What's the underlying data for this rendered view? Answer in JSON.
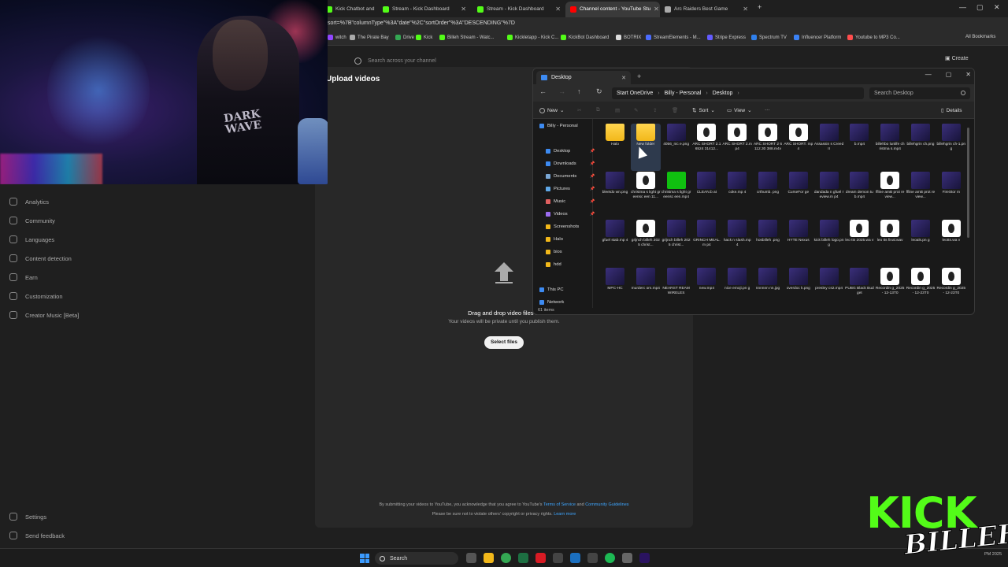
{
  "browser": {
    "tabs": [
      {
        "label": "Kick Chatbot and",
        "icon_color": "#53fc18"
      },
      {
        "label": "Stream - Kick Dashboard",
        "icon_color": "#53fc18"
      },
      {
        "label": "Stream - Kick Dashboard",
        "icon_color": "#53fc18"
      },
      {
        "label": "Channel content - YouTube Stu",
        "icon_color": "#ff0000"
      },
      {
        "label": "Arc Raiders Best Game",
        "icon_color": "#aaaaaa"
      }
    ],
    "url": "sort=%7B\"columnType\"%3A\"date\"%2C\"sortOrder\"%3A\"DESCENDING\"%7D",
    "bookmarks": [
      {
        "label": "witch",
        "color": "#9146ff"
      },
      {
        "label": "The Pirate Bay",
        "color": "#aaaaaa"
      },
      {
        "label": "Drive",
        "color": "#34a853"
      },
      {
        "label": "Kick",
        "color": "#53fc18"
      },
      {
        "label": "Billeh Stream - Watc...",
        "color": "#53fc18"
      },
      {
        "label": "Kickletapp - Kick C...",
        "color": "#53fc18"
      },
      {
        "label": "KickBot Dashboard",
        "color": "#53fc18"
      },
      {
        "label": "BOTRIX",
        "color": "#dddddd"
      },
      {
        "label": "StreamElements - M...",
        "color": "#4b6cff"
      },
      {
        "label": "Stripe Express",
        "color": "#635bff"
      },
      {
        "label": "Spectrum TV",
        "color": "#2f80ed"
      },
      {
        "label": "Influencer Platform",
        "color": "#3b82f6"
      },
      {
        "label": "Youtube to MP3 Co...",
        "color": "#ff4d4d"
      }
    ],
    "all_bookmarks": "All Bookmarks"
  },
  "youtube": {
    "search_placeholder": "Search across your channel",
    "create_label": "Create",
    "sidebar": [
      {
        "label": "Analytics"
      },
      {
        "label": "Community"
      },
      {
        "label": "Languages"
      },
      {
        "label": "Content detection"
      },
      {
        "label": "Earn"
      },
      {
        "label": "Customization"
      },
      {
        "label": "Creator Music [Beta]"
      }
    ],
    "sidebar_bottom": [
      {
        "label": "Settings"
      },
      {
        "label": "Send feedback"
      }
    ],
    "upload": {
      "title": "Upload videos",
      "drag_text": "Drag and drop video files to",
      "private_text": "Your videos will be private until you publish them.",
      "select_files": "Select files",
      "terms_prefix": "By submitting your videos to YouTube, you acknowledge that you agree to YouTube's",
      "terms_link": "Terms of Service",
      "terms_and": "and",
      "guidelines_link": "Community Guidelines",
      "copyright_text": "Please be sure not to violate others' copyright or privacy rights.",
      "learn_more": "Learn more"
    }
  },
  "explorer": {
    "tab_title": "Desktop",
    "breadcrumb": [
      "Start OneDrive",
      "Billy - Personal",
      "Desktop"
    ],
    "search_placeholder": "Search Desktop",
    "toolbar": {
      "new": "New",
      "sort": "Sort",
      "view": "View",
      "more": "···",
      "details": "Details"
    },
    "nav": [
      {
        "label": "Billy - Personal",
        "color": "#3d8bf2"
      },
      {
        "label": "Desktop",
        "color": "#3d8bf2",
        "pin": "📌"
      },
      {
        "label": "Downloads",
        "color": "#3d8bf2",
        "pin": "📌"
      },
      {
        "label": "Documents",
        "color": "#7aa7d6",
        "pin": "📌"
      },
      {
        "label": "Pictures",
        "color": "#5fa8e8",
        "pin": "📌"
      },
      {
        "label": "Music",
        "color": "#e06060",
        "pin": "📌"
      },
      {
        "label": "Videos",
        "color": "#9b6cf0",
        "pin": "📌"
      },
      {
        "label": "Screenshots",
        "color": "#f2b81a"
      },
      {
        "label": "Halo",
        "color": "#f2b81a"
      },
      {
        "label": "bios",
        "color": "#f2b81a"
      },
      {
        "label": "hdd",
        "color": "#f2b81a"
      },
      {
        "label": "This PC",
        "color": "#3d8bf2"
      },
      {
        "label": "Network",
        "color": "#3d8bf2"
      }
    ],
    "status": "61 items",
    "files": [
      {
        "label": "Halo",
        "kind": "folder"
      },
      {
        "label": "New folder",
        "kind": "folder"
      },
      {
        "label": "4056_nic e.png",
        "kind": "img"
      },
      {
        "label": "ARC SHORT 2.16524 31412...",
        "kind": "video"
      },
      {
        "label": "ARC SHORT 2.mp4",
        "kind": "video"
      },
      {
        "label": "ARC SHORT 2 6112.30 388.m4v",
        "kind": "video"
      },
      {
        "label": "ARC SHORT. mp4",
        "kind": "video"
      },
      {
        "label": "Assassin s Creed II",
        "kind": "img"
      },
      {
        "label": "b.mp4",
        "kind": "img"
      },
      {
        "label": "billehbo lunlife christma s.mp4",
        "kind": "img"
      },
      {
        "label": "billehgrin ch.png",
        "kind": "img"
      },
      {
        "label": "billehgrin ch-1.png",
        "kind": "img"
      },
      {
        "label": "bleetdo wn.png",
        "kind": "img"
      },
      {
        "label": "christma s light greensc een 11...",
        "kind": "video"
      },
      {
        "label": "christma s light greensc een.mp4",
        "kind": "green"
      },
      {
        "label": "CLEAN.b at",
        "kind": "img"
      },
      {
        "label": "coke.mp 4",
        "kind": "img"
      },
      {
        "label": "crthumb. png",
        "kind": "img"
      },
      {
        "label": "CurseFor ge",
        "kind": "img"
      },
      {
        "label": "dandada n gfuel review.m p4",
        "kind": "img"
      },
      {
        "label": "dream demon tub.mp4",
        "kind": "img"
      },
      {
        "label": "ffline amB prot review...",
        "kind": "video"
      },
      {
        "label": "ffline amB prot review...",
        "kind": "img"
      },
      {
        "label": "FireStor m",
        "kind": "img"
      },
      {
        "label": "gfuel stab.mp 4",
        "kind": "img"
      },
      {
        "label": "grijnch billeh 2025 christ...",
        "kind": "video"
      },
      {
        "label": "grijnch billeh 2025 christ...",
        "kind": "img"
      },
      {
        "label": "GRINCH MEAL.m p4",
        "kind": "img"
      },
      {
        "label": "hack n slash.mp 4",
        "kind": "img"
      },
      {
        "label": "hosbilleh .png",
        "kind": "img"
      },
      {
        "label": "HYTE Nexus",
        "kind": "img"
      },
      {
        "label": "kick billeh logo.png",
        "kind": "img"
      },
      {
        "label": "leo tts 2025.wa v",
        "kind": "video"
      },
      {
        "label": "leo tts final.wav",
        "kind": "video"
      },
      {
        "label": "leoals.pn g",
        "kind": "img"
      },
      {
        "label": "leotts.wa v",
        "kind": "video"
      },
      {
        "label": "MPC-HC",
        "kind": "img"
      },
      {
        "label": "murderc om.mp4",
        "kind": "img"
      },
      {
        "label": "NEARST REAM WIRELES",
        "kind": "img"
      },
      {
        "label": "new.mp4",
        "kind": "img"
      },
      {
        "label": "nice emoji.pn g",
        "kind": "img"
      },
      {
        "label": "nnnnnn nn.jpg",
        "kind": "img"
      },
      {
        "label": "overdoc k.png",
        "kind": "img"
      },
      {
        "label": "presley cs2.mp4",
        "kind": "img"
      },
      {
        "label": "PUBG Black Budget",
        "kind": "img"
      },
      {
        "label": "Recordin g_2025- 12-13T0",
        "kind": "video"
      },
      {
        "label": "Recordin g_2025- 12-23T0",
        "kind": "video"
      },
      {
        "label": "Recordin g_2025- 12-23T0",
        "kind": "video"
      }
    ]
  },
  "overlay": {
    "shirt_text": "DARK WAVE",
    "logo_top": "KICK",
    "logo_bottom": "BILLEH"
  },
  "taskbar": {
    "search_label": "Search",
    "tray": "PM 2025"
  }
}
